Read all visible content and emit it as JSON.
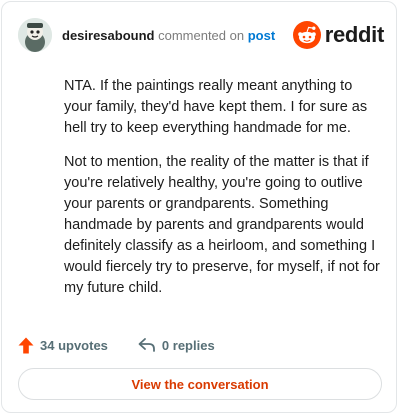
{
  "header": {
    "username": "desiresabound",
    "commented_text": "commented on",
    "post_link": "post",
    "brand": "reddit",
    "brand_color": "#ff4500",
    "avatar_icon": "user-avatar-icon"
  },
  "comment": {
    "paragraphs": [
      "NTA. If the paintings really meant anything to your family, they'd have kept them. I for sure as hell try to keep everything handmade for me.",
      "Not to mention, the reality of the matter is that if you're relatively healthy, you're going to outlive your parents or grandparents. Something handmade by parents and grandparents would definitely classify as a heirloom, and something I would fiercely try to preserve, for myself, if not for my future child."
    ]
  },
  "actions": {
    "upvotes": "34 upvotes",
    "upvote_icon": "upvote-arrow-icon",
    "upvote_color": "#ff4500",
    "replies": "0 replies",
    "reply_icon": "reply-icon"
  },
  "cta": {
    "label": "View the conversation",
    "color": "#d93a00"
  }
}
